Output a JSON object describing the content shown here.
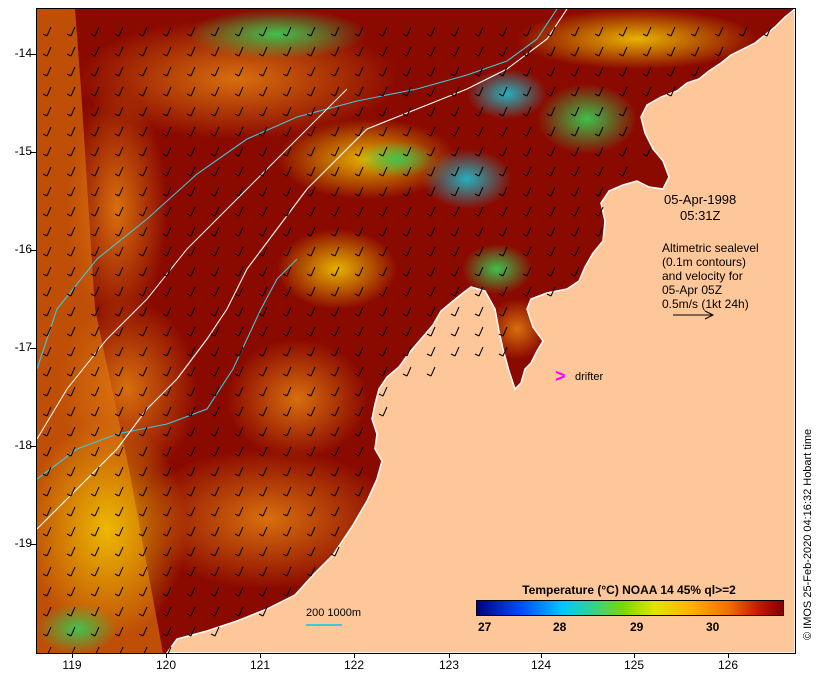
{
  "map": {
    "date": "05-Apr-1998",
    "time": "05:31Z",
    "altimetry_lines": [
      "Altimetric sealevel",
      "(0.1m contours)",
      "and velocity for",
      "05-Apr 05Z",
      "0.5m/s (1kt 24h)"
    ],
    "drifter_label": "drifter",
    "drifter_symbol": ">",
    "scale_label": "200  1000m",
    "side_stamp": "© IMOS 25-Feb-2020 04:16:32 Hobart time",
    "colors": {
      "ocean_warm": "#8b0a00",
      "land": "#fec79a",
      "coast": "#ffffff",
      "contour": "#3ec8d8",
      "drifter": "#ff00ff"
    }
  },
  "axes": {
    "y_labels": [
      "-14",
      "-15",
      "-16",
      "-17",
      "-18",
      "-19"
    ],
    "x_labels": [
      "119",
      "120",
      "121",
      "122",
      "123",
      "124",
      "125",
      "126"
    ]
  },
  "colorbar": {
    "title": "Temperature (°C) NOAA 14 45% ql>=2",
    "labels": [
      "27",
      "28",
      "29",
      "30"
    ]
  }
}
